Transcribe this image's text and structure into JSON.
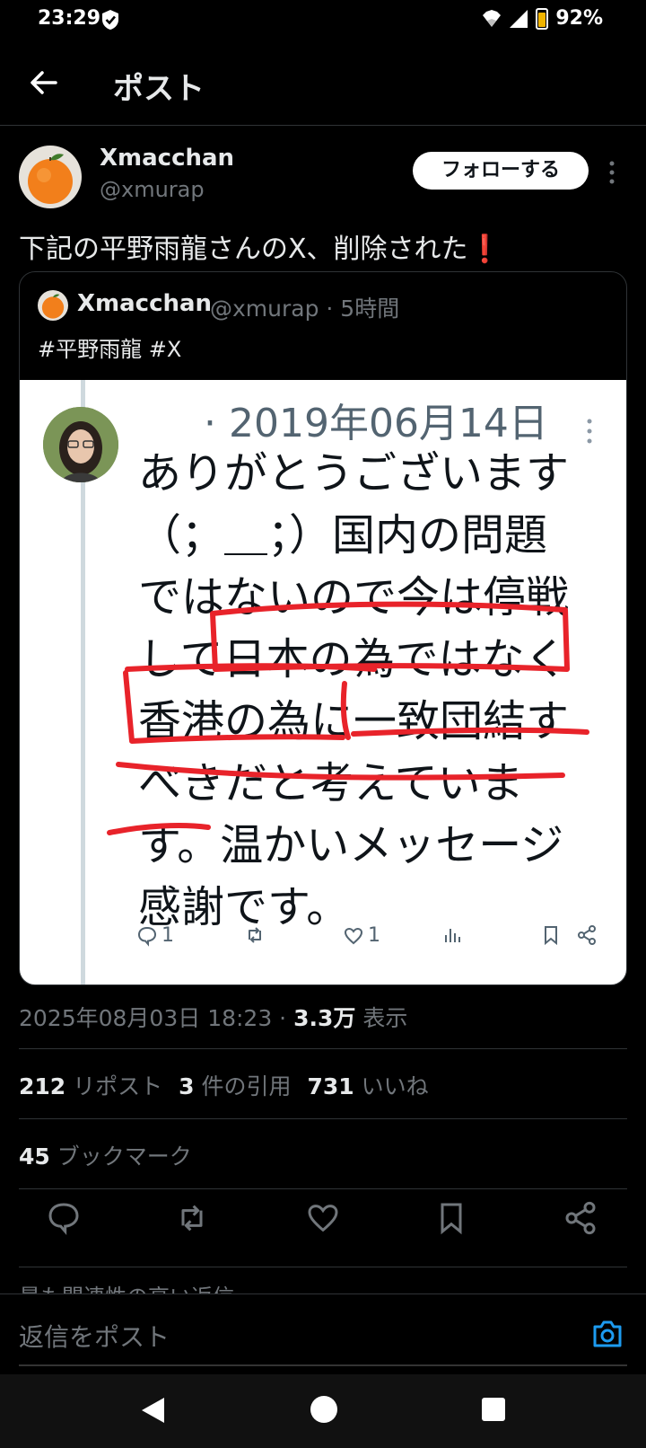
{
  "status": {
    "time": "23:29",
    "battery": "92%"
  },
  "header": {
    "title": "ポスト"
  },
  "post": {
    "author_name": "Xmacchan",
    "author_handle": "@xmurap",
    "follow_label": "フォローする",
    "text": "下記の平野雨龍さんのX、削除された",
    "text_mark": "❗"
  },
  "quote": {
    "name": "Xmacchan",
    "meta": "@xmurap · 5時間",
    "tags": "#平野雨龍 #X",
    "image": {
      "date": "· 2019年06月14日",
      "lines": [
        "ありがとうございます",
        "（；＿；）国内の問題",
        "ではないので今は停戦",
        "して日本の為ではなく",
        "香港の為に一致団結す",
        "べきだと考えていま",
        "す。温かいメッセージ",
        "感謝です。"
      ],
      "reply_count": "1",
      "like_count": "1"
    }
  },
  "timestamp": {
    "datetime": "2025年08月03日 18:23 · ",
    "views": "3.3万",
    "views_label": " 表示"
  },
  "stats": {
    "reposts": "212",
    "reposts_label": " リポスト",
    "quotes": "3",
    "quotes_label": " 件の引用",
    "likes": "731",
    "likes_label": " いいね",
    "bookmarks": "45",
    "bookmarks_label": " ブックマーク"
  },
  "reply": {
    "cut_text": "最も関連性の高い返信",
    "placeholder": "返信をポスト"
  },
  "colors": {
    "accent": "#1d9bf0",
    "background": "#000000",
    "muted": "#71767b",
    "alert_red": "#e0102f"
  }
}
